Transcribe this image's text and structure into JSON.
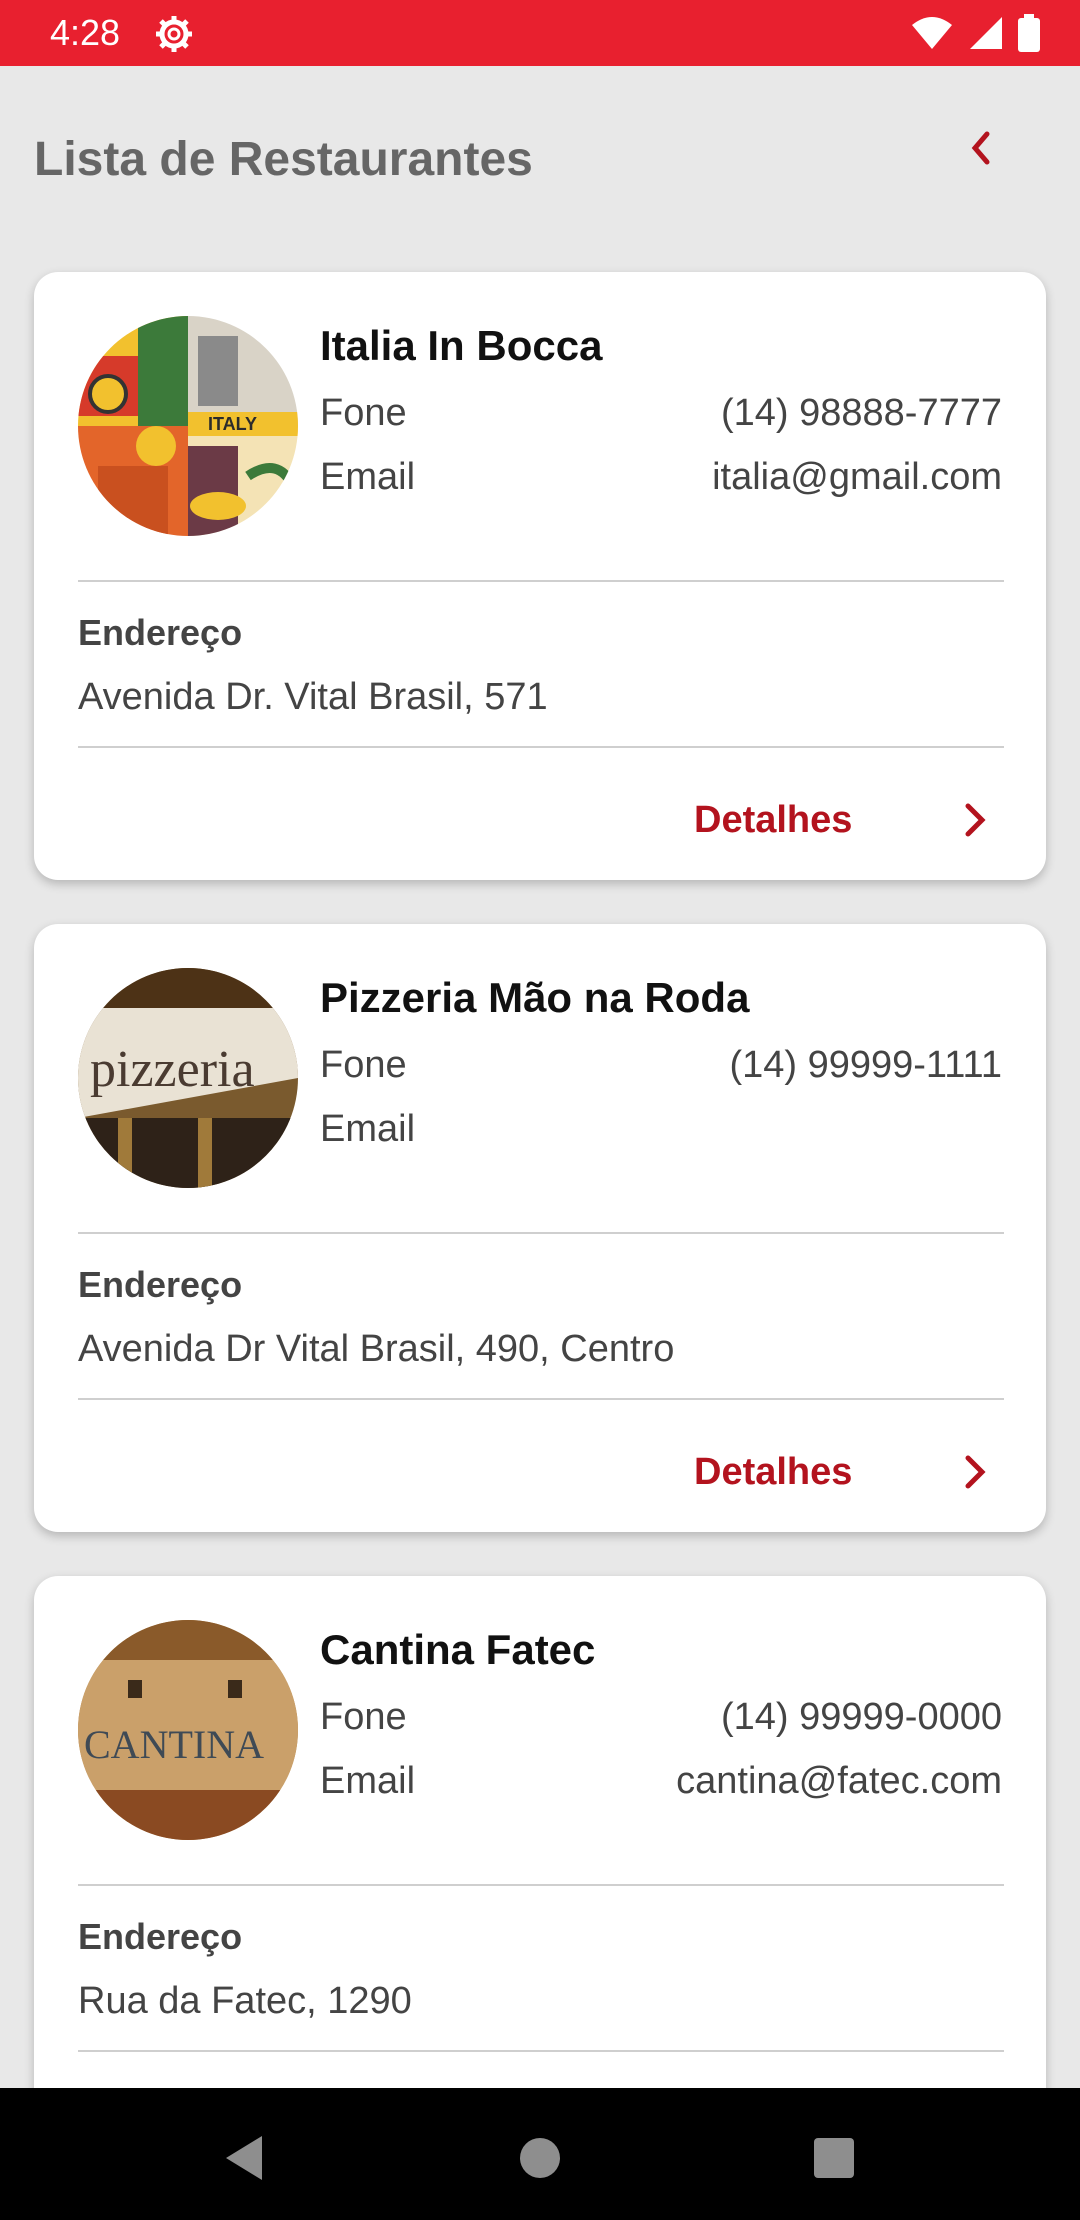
{
  "status": {
    "time": "4:28",
    "icons": [
      "settings-icon",
      "wifi-icon",
      "signal-icon",
      "battery-icon"
    ]
  },
  "header": {
    "title": "Lista de Restaurantes",
    "back_icon": "chevron-left-icon"
  },
  "colors": {
    "status_bar": "#e8202f",
    "accent": "#b3131e",
    "background": "#e8e8e8",
    "card": "#ffffff"
  },
  "restaurants": [
    {
      "name": "Italia In Bocca",
      "phone_label": "Fone",
      "phone": "(14) 98888-7777",
      "email_label": "Email",
      "email": "italia@gmail.com",
      "address_label": "Endereço",
      "address": "Avenida Dr. Vital Brasil, 571",
      "details_label": "Detalhes",
      "image_text": "ITALY"
    },
    {
      "name": "Pizzeria Mão na Roda",
      "phone_label": "Fone",
      "phone": "(14) 99999-1111",
      "email_label": "Email",
      "email": "",
      "address_label": "Endereço",
      "address": "Avenida Dr Vital Brasil, 490, Centro",
      "details_label": "Detalhes",
      "image_text": "pizzeria"
    },
    {
      "name": "Cantina Fatec",
      "phone_label": "Fone",
      "phone": "(14) 99999-0000",
      "email_label": "Email",
      "email": "cantina@fatec.com",
      "address_label": "Endereço",
      "address": "Rua da Fatec, 1290",
      "details_label": "",
      "image_text": "CANTINA"
    }
  ],
  "navigation": {
    "buttons": [
      "back-nav-icon",
      "home-nav-icon",
      "recents-nav-icon"
    ]
  }
}
